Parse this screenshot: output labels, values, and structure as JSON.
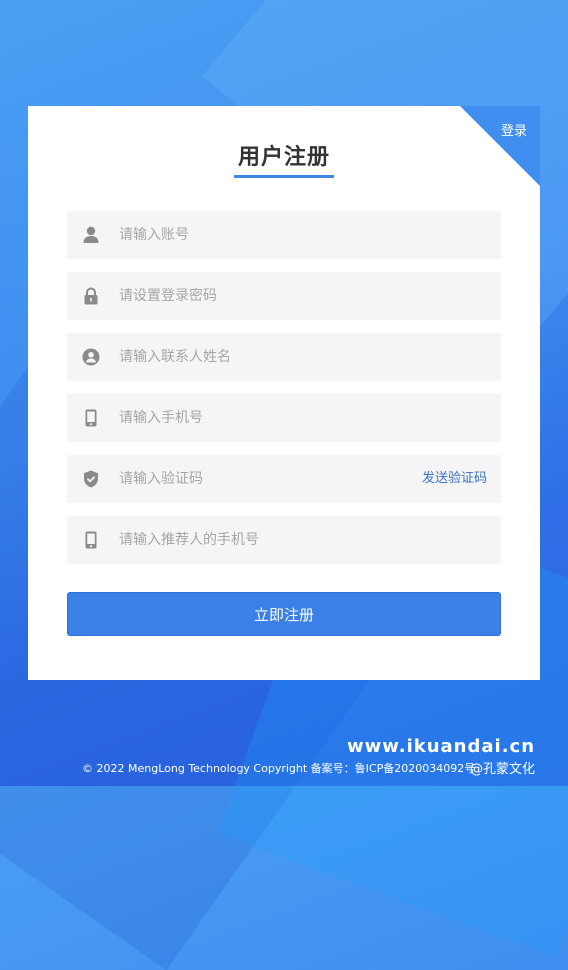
{
  "header": {
    "corner_link": "登录",
    "title": "用户注册"
  },
  "form": {
    "fields": [
      {
        "icon": "user-icon",
        "placeholder": "请输入账号"
      },
      {
        "icon": "lock-icon",
        "placeholder": "请设置登录密码"
      },
      {
        "icon": "contact-icon",
        "placeholder": "请输入联系人姓名"
      },
      {
        "icon": "phone-icon",
        "placeholder": "请输入手机号"
      },
      {
        "icon": "shield-icon",
        "placeholder": "请输入验证码",
        "action": "发送验证码"
      },
      {
        "icon": "phone-icon",
        "placeholder": "请输入推荐人的手机号"
      }
    ],
    "submit_label": "立即注册"
  },
  "footer": {
    "copyright": "© 2022 MengLong Technology Copyright 备案号：鲁ICP备2020034092号"
  },
  "watermark": {
    "url": "www.ikuandai.cn",
    "brand": "@孔蒙文化"
  },
  "colors": {
    "accent": "#3b80e6",
    "field_bg": "#f5f5f5",
    "link": "#3a72c4"
  }
}
